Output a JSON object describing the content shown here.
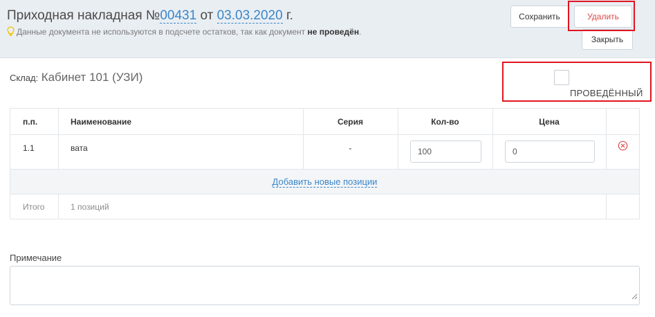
{
  "header": {
    "title_prefix": "Приходная накладная №",
    "doc_number": "00431",
    "title_middle": "от",
    "doc_date": "03.03.2020",
    "title_suffix": "г.",
    "notice_text": "Данные документа не используются в подсчете остатков, так как документ",
    "notice_bold": "не проведён",
    "notice_end": "."
  },
  "buttons": {
    "save": "Сохранить",
    "delete": "Удалить",
    "close": "Закрыть"
  },
  "warehouse": {
    "label": "Склад:",
    "value": "Кабинет 101 (УЗИ)"
  },
  "posted": {
    "label": "ПРОВЕДЁННЫЙ",
    "checked": false
  },
  "table": {
    "headers": {
      "num": "п.п.",
      "name": "Наименование",
      "series": "Серия",
      "qty": "Кол-во",
      "price": "Цена"
    },
    "rows": [
      {
        "num": "1.1",
        "name": "вата",
        "series": "-",
        "qty": "100",
        "price": "0"
      }
    ],
    "add_link": "Добавить новые позиции",
    "total_label": "Итого",
    "total_value": "1 позиций"
  },
  "note": {
    "label": "Примечание",
    "value": ""
  },
  "colors": {
    "accent": "#3a86c8",
    "danger": "#e04646",
    "highlight": "#e0141e",
    "header_bg": "#e9eef3"
  },
  "icons": {
    "notice": "lightbulb-icon",
    "remove": "remove-circle-icon"
  }
}
